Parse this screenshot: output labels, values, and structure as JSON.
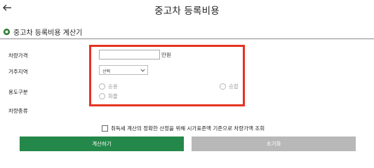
{
  "header": {
    "title": "중고차 등록비용"
  },
  "section": {
    "title": "중고차 등록비용 계산기"
  },
  "form": {
    "price": {
      "label": "차량가격",
      "value": "",
      "unit": "만원"
    },
    "region": {
      "label": "거주지역",
      "selected": "선택"
    },
    "usage": {
      "label": "용도구분",
      "options": [
        "승용",
        "승합",
        "화물"
      ]
    },
    "vehicle_type": {
      "label": "차량종류"
    }
  },
  "agreement": {
    "text": "취득세 계산의 정확한 산정을 위해 시가표준액 기준으로 차량가액 조회"
  },
  "buttons": {
    "calculate": "계산하기",
    "reset": "초기화"
  },
  "colors": {
    "highlight": "#e53321",
    "primary": "#24884a",
    "disabled": "#b8b8b8",
    "brand_icon": "#2e7d32"
  }
}
